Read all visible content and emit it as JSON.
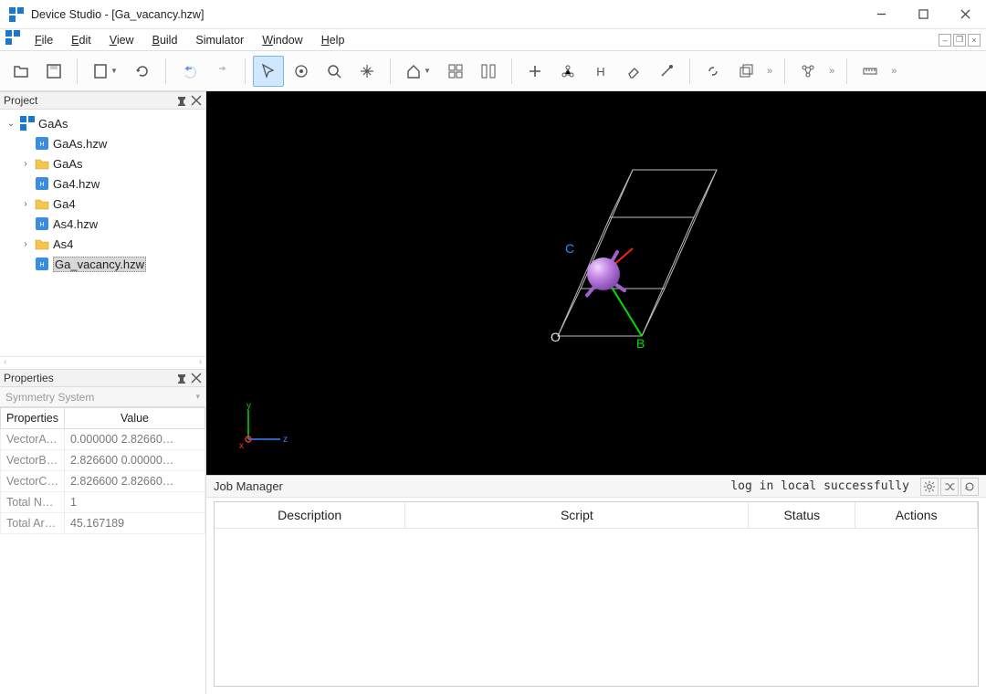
{
  "app": {
    "title": "Device Studio - [Ga_vacancy.hzw]"
  },
  "menu": {
    "file": "File",
    "edit": "Edit",
    "view": "View",
    "build": "Build",
    "simulator": "Simulator",
    "window": "Window",
    "help": "Help"
  },
  "panels": {
    "project_title": "Project",
    "properties_title": "Properties",
    "properties_combo": "Symmetry System",
    "prop_headers": {
      "k": "Properties",
      "v": "Value"
    }
  },
  "project_tree": {
    "root": "GaAs",
    "items": [
      {
        "label": "GaAs.hzw",
        "kind": "file"
      },
      {
        "label": "GaAs",
        "kind": "folder",
        "expandable": true
      },
      {
        "label": "Ga4.hzw",
        "kind": "file"
      },
      {
        "label": "Ga4",
        "kind": "folder",
        "expandable": true
      },
      {
        "label": "As4.hzw",
        "kind": "file"
      },
      {
        "label": "As4",
        "kind": "folder",
        "expandable": true
      },
      {
        "label": "Ga_vacancy.hzw",
        "kind": "file",
        "selected": true
      }
    ]
  },
  "properties": {
    "rows": [
      {
        "k": "VectorA (xyz)",
        "v": "0.000000 2.82660…"
      },
      {
        "k": "VectorB (xyz)",
        "v": "2.826600 0.00000…"
      },
      {
        "k": "VectorC (x…",
        "v": "2.826600 2.82660…"
      },
      {
        "k": "Total Num …",
        "v": "1"
      },
      {
        "k": "Total Area …",
        "v": "45.167189"
      }
    ]
  },
  "viewport": {
    "axis_labels": {
      "x": "x",
      "y": "y",
      "z": "z"
    },
    "scene_labels": {
      "O": "O",
      "B": "B",
      "C": "C"
    }
  },
  "job_manager": {
    "title": "Job Manager",
    "status": "log in local successfully",
    "columns": [
      "Description",
      "Script",
      "Status",
      "Actions"
    ]
  }
}
